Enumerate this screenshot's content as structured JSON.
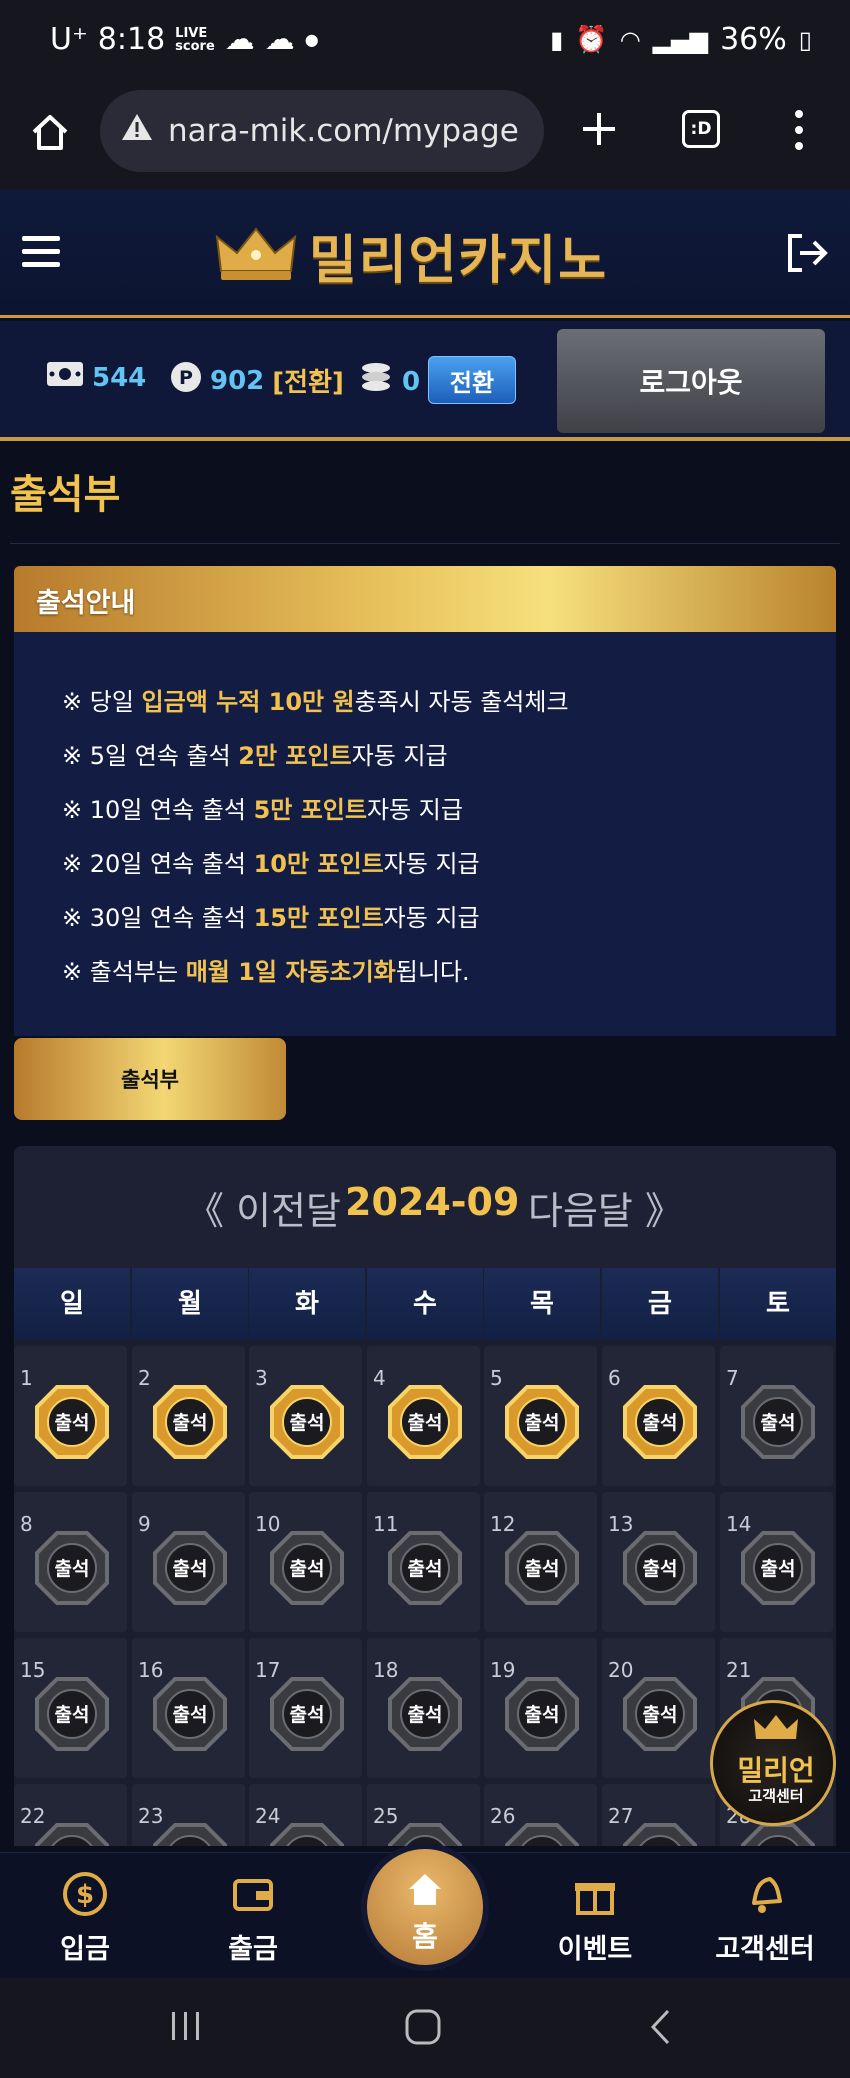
{
  "status_bar": {
    "carrier": "U⁺",
    "time": "8:18",
    "live_top": "LIVE",
    "live_bottom": "score",
    "battery": "36%"
  },
  "browser": {
    "url": "nara-mik.com/mypage",
    "tabs_label": ":D"
  },
  "header": {
    "logo_text": "밀리언카지노"
  },
  "balance": {
    "money": "544",
    "points": "902",
    "convert_link": "[전환]",
    "coins": "0",
    "convert_button": "전환",
    "logout_button": "로그아웃"
  },
  "page_title": "출석부",
  "guide": {
    "heading": "출석안내",
    "rules": [
      {
        "pre": "※ 당일 ",
        "hl": "입금액 누적 10만 원",
        "post": "충족시 자동 출석체크"
      },
      {
        "pre": "※ 5일 연속 출석 ",
        "hl": "2만 포인트",
        "post": "자동 지급"
      },
      {
        "pre": "※ 10일 연속 출석 ",
        "hl": "5만 포인트",
        "post": "자동 지급"
      },
      {
        "pre": "※ 20일 연속 출석 ",
        "hl": "10만 포인트",
        "post": "자동 지급"
      },
      {
        "pre": "※ 30일 연속 출석 ",
        "hl": "15만 포인트",
        "post": "자동 지급"
      },
      {
        "pre": "※ 출석부는 ",
        "hl": "매월 1일 자동초기화",
        "post": "됩니다."
      }
    ]
  },
  "attendance_button": "출석부",
  "calendar": {
    "prev_label": "《 이전달",
    "month": "2024-09",
    "next_label": "다음달 》",
    "weekdays": [
      "일",
      "월",
      "화",
      "수",
      "목",
      "금",
      "토"
    ],
    "badge_text": "출석",
    "days": [
      {
        "day": "1",
        "attended": true
      },
      {
        "day": "2",
        "attended": true
      },
      {
        "day": "3",
        "attended": true
      },
      {
        "day": "4",
        "attended": true
      },
      {
        "day": "5",
        "attended": true
      },
      {
        "day": "6",
        "attended": true
      },
      {
        "day": "7",
        "attended": false
      },
      {
        "day": "8",
        "attended": false
      },
      {
        "day": "9",
        "attended": false
      },
      {
        "day": "10",
        "attended": false
      },
      {
        "day": "11",
        "attended": false
      },
      {
        "day": "12",
        "attended": false
      },
      {
        "day": "13",
        "attended": false
      },
      {
        "day": "14",
        "attended": false
      },
      {
        "day": "15",
        "attended": false
      },
      {
        "day": "16",
        "attended": false
      },
      {
        "day": "17",
        "attended": false
      },
      {
        "day": "18",
        "attended": false
      },
      {
        "day": "19",
        "attended": false
      },
      {
        "day": "20",
        "attended": false
      },
      {
        "day": "21",
        "attended": false
      },
      {
        "day": "22",
        "attended": false
      },
      {
        "day": "23",
        "attended": false
      },
      {
        "day": "24",
        "attended": false
      },
      {
        "day": "25",
        "attended": false
      },
      {
        "day": "26",
        "attended": false
      },
      {
        "day": "27",
        "attended": false
      },
      {
        "day": "28",
        "attended": false
      }
    ]
  },
  "cs_float": {
    "title": "밀리언",
    "subtitle": "고객센터"
  },
  "bottom_nav": {
    "deposit": "입금",
    "withdraw": "출금",
    "home": "홈",
    "event": "이벤트",
    "support": "고객센터"
  },
  "colors": {
    "gold": "#f2c24e",
    "navy": "#0f1838",
    "stat_blue": "#63c3f2"
  }
}
